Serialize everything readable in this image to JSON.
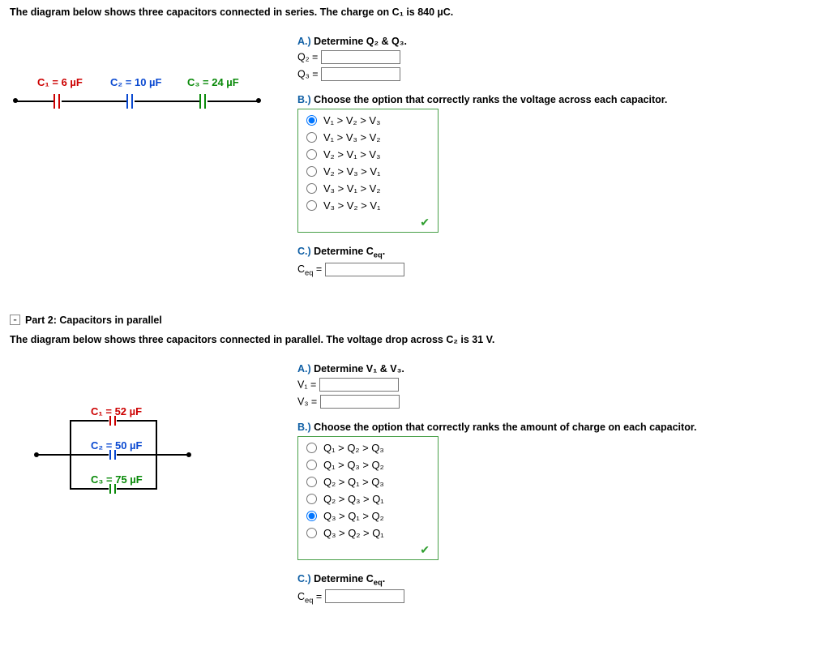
{
  "part1": {
    "intro": "The diagram below shows three capacitors connected in series. The charge on C₁ is 840 µC.",
    "diagram": {
      "c1": "C₁ = 6 µF",
      "c2": "C₂ = 10 µF",
      "c3": "C₃ = 24 µF"
    },
    "a": {
      "pfx": "A.)",
      "title": "Determine Q₂ & Q₃.",
      "q2_label": "Q₂ =",
      "q3_label": "Q₃ =",
      "q2_value": "",
      "q3_value": ""
    },
    "b": {
      "pfx": "B.)",
      "title": "Choose the option that correctly ranks the voltage across each capacitor.",
      "options": [
        "V₁ > V₂ > V₃",
        "V₁ > V₃ > V₂",
        "V₂ > V₁ > V₃",
        "V₂ > V₃ > V₁",
        "V₃ > V₁ > V₂",
        "V₃ > V₂ > V₁"
      ],
      "selected": 0
    },
    "c": {
      "pfx": "C.)",
      "title": "Determine C_eq.",
      "ceq_label": "Cₑq =",
      "ceq_value": ""
    }
  },
  "part2": {
    "header": "Part 2: Capacitors in parallel",
    "intro": "The diagram below shows three capacitors connected in parallel. The voltage drop across C₂ is 31 V.",
    "diagram": {
      "c1": "C₁ = 52 µF",
      "c2": "C₂ = 50 µF",
      "c3": "C₃ = 75 µF"
    },
    "a": {
      "pfx": "A.)",
      "title": "Determine V₁ & V₃.",
      "v1_label": "V₁ =",
      "v3_label": "V₃ =",
      "v1_value": "",
      "v3_value": ""
    },
    "b": {
      "pfx": "B.)",
      "title": "Choose the option that correctly ranks the amount of charge on each capacitor.",
      "options": [
        "Q₁ > Q₂ > Q₃",
        "Q₁ > Q₃ > Q₂",
        "Q₂ > Q₁ > Q₃",
        "Q₂ > Q₃ > Q₁",
        "Q₃ > Q₁ > Q₂",
        "Q₃ > Q₂ > Q₁"
      ],
      "selected": 4
    },
    "c": {
      "pfx": "C.)",
      "title": "Determine C_eq.",
      "ceq_label": "Cₑq =",
      "ceq_value": ""
    }
  }
}
